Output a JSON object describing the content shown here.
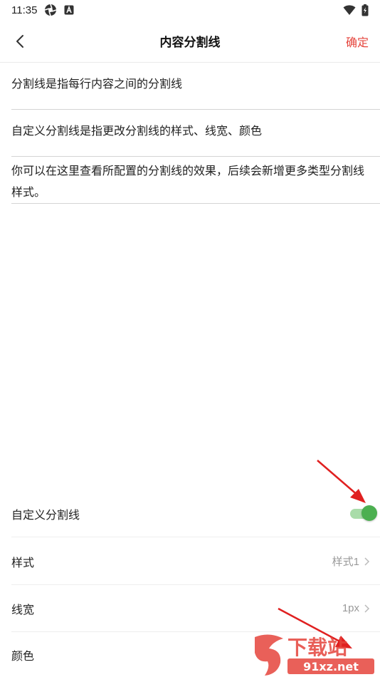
{
  "status_bar": {
    "time": "11:35",
    "left_icons": [
      "aperture-icon",
      "a-badge-icon"
    ],
    "right_icons": [
      "wifi-icon",
      "battery-icon"
    ]
  },
  "nav": {
    "title": "内容分割线",
    "confirm_label": "确定",
    "back_icon": "chevron-left-icon"
  },
  "text_blocks": [
    "分割线是指每行内容之间的分割线",
    "自定义分割线是指更改分割线的样式、线宽、颜色",
    "你可以在这里查看所配置的分割线的效果，后续会新增更多类型分割线样式。"
  ],
  "settings": {
    "custom_divider": {
      "label": "自定义分割线",
      "enabled": true
    },
    "style": {
      "label": "样式",
      "value": "样式1"
    },
    "width": {
      "label": "线宽",
      "value": "1px"
    },
    "color": {
      "label": "颜色"
    }
  },
  "watermark": {
    "text": "下载站",
    "url_text": "91xz.net"
  },
  "colors": {
    "accent": "#e5443c",
    "toggle_on": "#4caf50",
    "arrow": "#e02020"
  }
}
